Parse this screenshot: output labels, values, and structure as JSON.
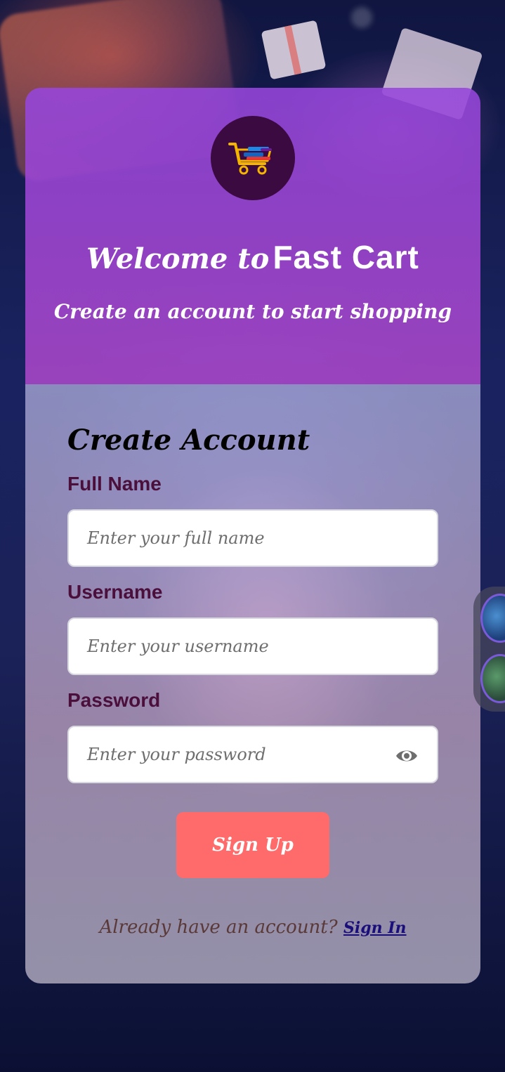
{
  "header": {
    "welcome_prefix": "Welcome to",
    "brand": "Fast Cart",
    "subtitle": "Create an account to start shopping"
  },
  "form": {
    "title": "Create Account",
    "fields": [
      {
        "label": "Full Name",
        "placeholder": "Enter your full name"
      },
      {
        "label": "Username",
        "placeholder": "Enter your username"
      },
      {
        "label": "Password",
        "placeholder": "Enter your password"
      }
    ],
    "submit_label": "Sign Up"
  },
  "footer": {
    "prompt": "Already have an account?",
    "link_label": "Sign In"
  },
  "icons": {
    "logo": "shopping-cart-icon",
    "password_toggle": "eye-icon"
  },
  "colors": {
    "header_bg": "#9646dc",
    "logo_bg": "#3a0a40",
    "label": "#4a0f3a",
    "button": "#ff6b6b",
    "link": "#1a0f7a"
  }
}
